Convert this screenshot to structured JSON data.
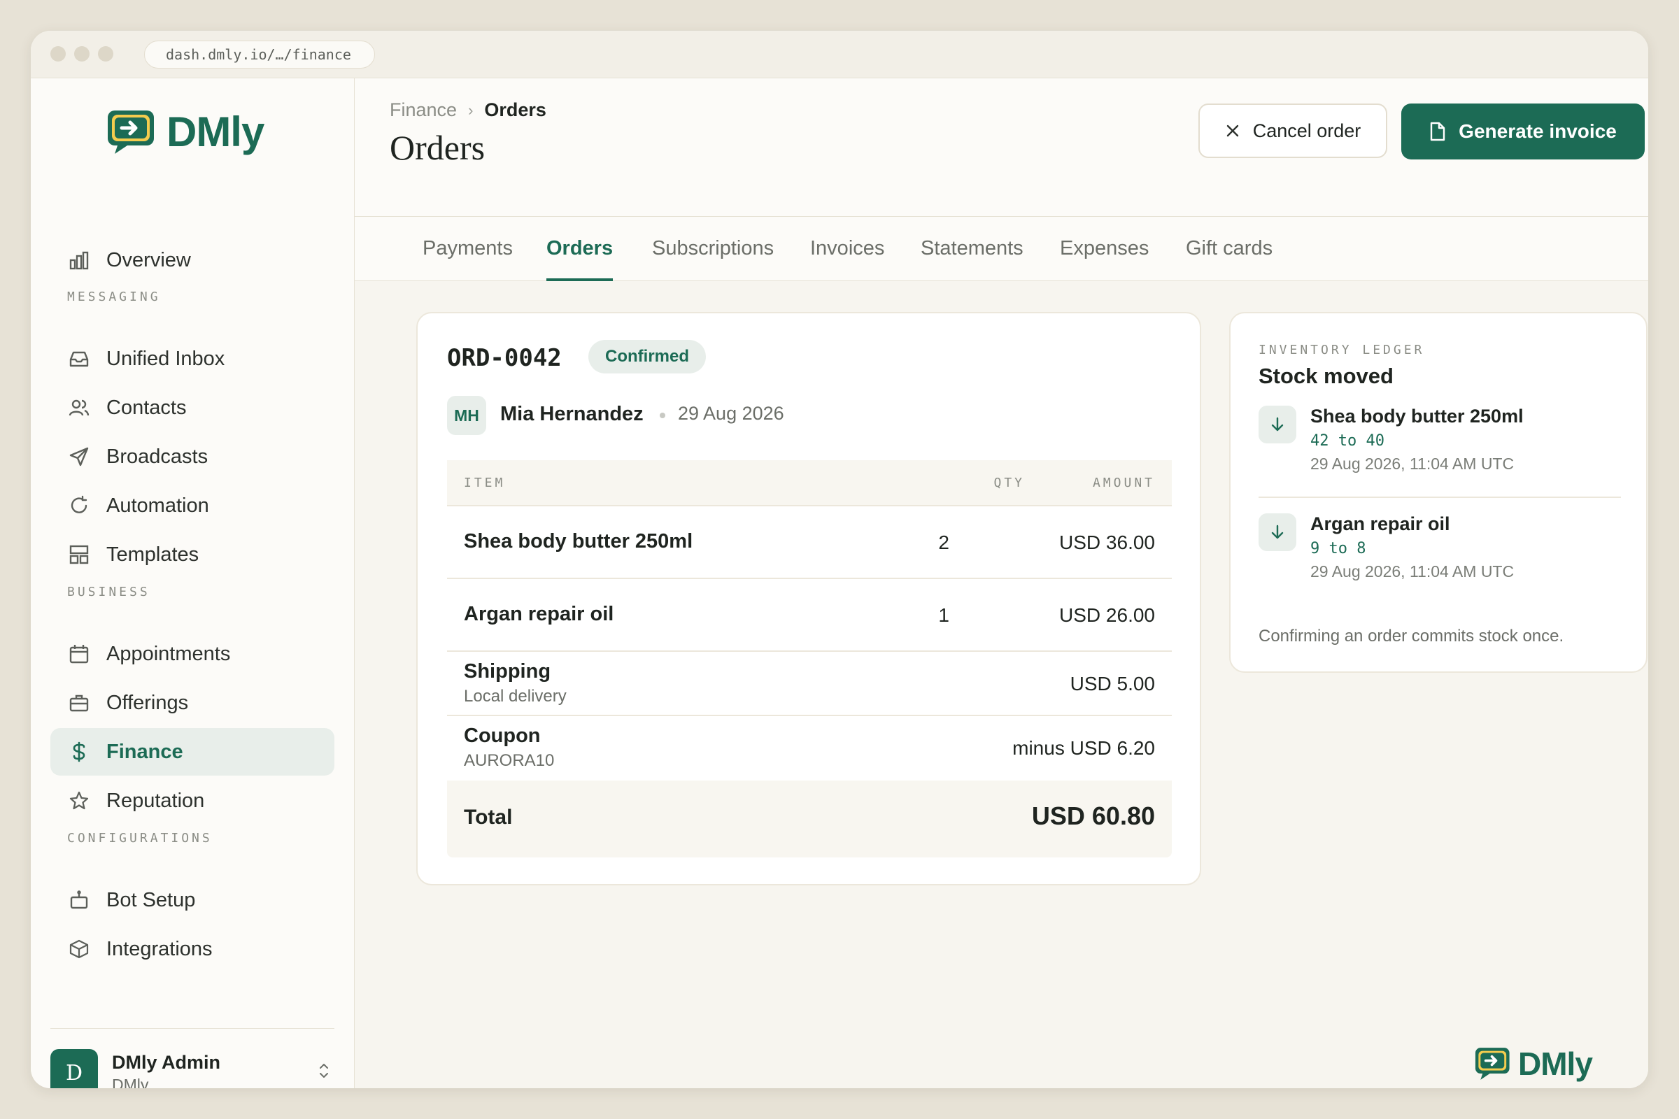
{
  "browser": {
    "url": "dash.dmly.io/…/finance"
  },
  "brand": {
    "name": "DMly",
    "accent": "#1c6b55"
  },
  "sidebar": {
    "overview": "Overview",
    "sections": {
      "messaging": "MESSAGING",
      "business": "BUSINESS",
      "configurations": "CONFIGURATIONS"
    },
    "items": {
      "unified_inbox": "Unified Inbox",
      "contacts": "Contacts",
      "broadcasts": "Broadcasts",
      "automation": "Automation",
      "templates": "Templates",
      "appointments": "Appointments",
      "offerings": "Offerings",
      "finance": "Finance",
      "reputation": "Reputation",
      "bot_setup": "Bot Setup",
      "integrations": "Integrations"
    },
    "active": "finance",
    "user": {
      "initial": "D",
      "name": "DMly Admin",
      "org": "DMly"
    }
  },
  "header": {
    "breadcrumb": [
      "Finance",
      "Orders"
    ],
    "title": "Orders",
    "cancel_label": "Cancel order",
    "generate_label": "Generate invoice"
  },
  "tabs": [
    "Payments",
    "Orders",
    "Subscriptions",
    "Invoices",
    "Statements",
    "Expenses",
    "Gift cards"
  ],
  "active_tab": "Orders",
  "order": {
    "id": "ORD-0042",
    "status": "Confirmed",
    "customer": {
      "initials": "MH",
      "name": "Mia Hernandez"
    },
    "date": "29 Aug 2026",
    "columns": {
      "item": "ITEM",
      "qty": "QTY",
      "amount": "AMOUNT"
    },
    "lines": [
      {
        "name": "Shea body butter 250ml",
        "qty": "2",
        "amount": "USD 36.00"
      },
      {
        "name": "Argan repair oil",
        "qty": "1",
        "amount": "USD 26.00"
      }
    ],
    "shipping": {
      "label": "Shipping",
      "sub": "Local delivery",
      "amount": "USD 5.00"
    },
    "coupon": {
      "label": "Coupon",
      "code": "AURORA10",
      "amount": "minus USD 6.20"
    },
    "total": {
      "label": "Total",
      "amount": "USD 60.80"
    }
  },
  "ledger": {
    "eyebrow": "INVENTORY LEDGER",
    "title": "Stock moved",
    "entries": [
      {
        "name": "Shea body butter 250ml",
        "change": "42 to 40",
        "time": "29 Aug 2026, 11:04 AM UTC"
      },
      {
        "name": "Argan repair oil",
        "change": "9 to 8",
        "time": "29 Aug 2026, 11:04 AM UTC"
      }
    ],
    "note": "Confirming an order commits stock once."
  },
  "watermark": "DMly"
}
